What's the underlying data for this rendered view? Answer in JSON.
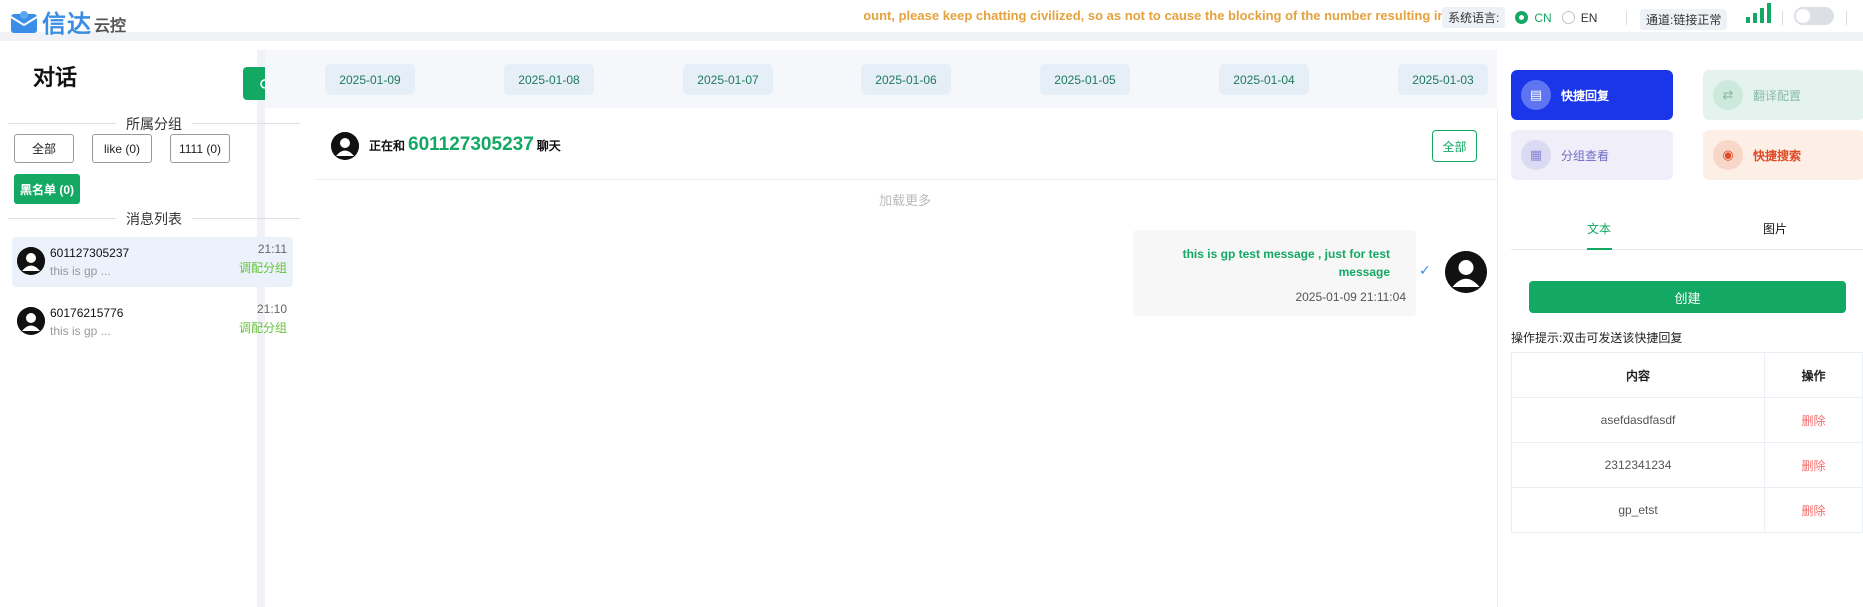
{
  "header": {
    "brand_main": "信达",
    "brand_sub": "云控",
    "marquee": "count, please keep chatting civilized, so as not to cause the blocking of the number resulting in the inability to use",
    "language_label": "系统语言:",
    "lang_options": [
      "CN",
      "EN"
    ],
    "lang_selected": "CN",
    "channel_label": "通道:",
    "channel_status": "链接正常",
    "accent": "#13a863"
  },
  "left": {
    "title": "对话",
    "group_section": "所属分组",
    "groups": [
      "全部",
      "like (0)",
      "1111 (0)"
    ],
    "blacklist": "黑名单 (0)",
    "messages_section": "消息列表",
    "chats": [
      {
        "name": "601127305237",
        "preview": "this is gp ...",
        "time": "21:11",
        "action": "调配分组"
      },
      {
        "name": "60176215776",
        "preview": "this is gp ...",
        "time": "21:10",
        "action": "调配分组"
      }
    ]
  },
  "middle": {
    "dates": [
      "2025-01-09",
      "2025-01-08",
      "2025-01-07",
      "2025-01-06",
      "2025-01-05",
      "2025-01-04",
      "2025-01-03"
    ],
    "chat_prefix": "正在和",
    "chat_number": "601127305237",
    "chat_suffix": "聊天",
    "all_button": "全部",
    "load_more": "加载更多",
    "message": {
      "text": "this is gp test message , just for test message",
      "timestamp": "2025-01-09 21:11:04"
    }
  },
  "right": {
    "tools": [
      {
        "label": "快捷回复",
        "icon": "chat-icon"
      },
      {
        "label": "翻译配置",
        "icon": "translate-icon"
      },
      {
        "label": "分组查看",
        "icon": "grid-icon"
      },
      {
        "label": "快捷搜索",
        "icon": "alarm-icon"
      }
    ],
    "tabs": [
      "文本",
      "图片"
    ],
    "create_button": "创建",
    "tip": "操作提示:双击可发送该快捷回复",
    "table_headers": [
      "内容",
      "操作"
    ],
    "rows": [
      {
        "content": "asefdasdfasdf",
        "action": "删除"
      },
      {
        "content": "2312341234",
        "action": "删除"
      },
      {
        "content": "gp_etst",
        "action": "删除"
      }
    ]
  }
}
